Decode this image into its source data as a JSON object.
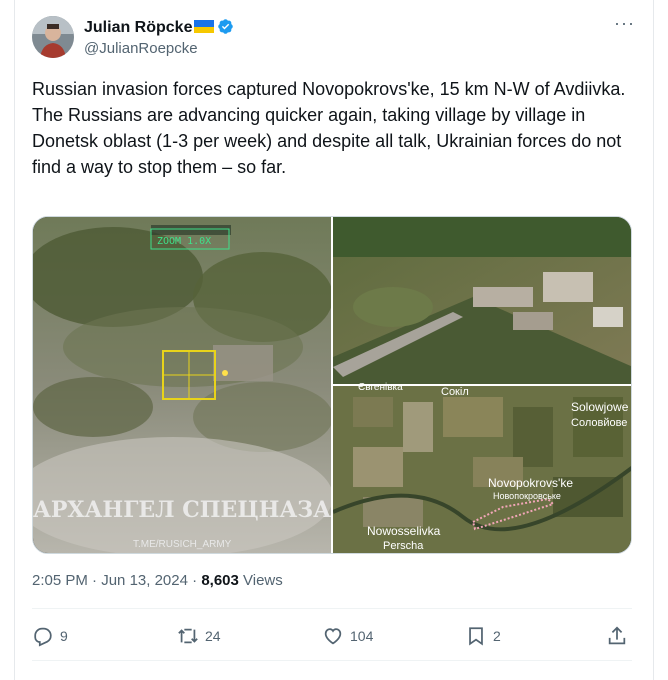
{
  "author": {
    "display_name": "Julian Röpcke",
    "handle": "@JulianRoepcke"
  },
  "tweet": {
    "line1": "Russian invasion forces captured Novopokrovs'ke, 15 km N-W of Avdiivka.",
    "line2": "The Russians are advancing quicker again, taking village by village in Donetsk oblast (1-3 per week) and despite all talk, Ukrainian forces do not find a way to stop them – so far."
  },
  "media": {
    "left": {
      "hud_zoom": "ZOOM 1.0X",
      "watermark": "АРХАНГЕЛ СПЕЦНАЗА",
      "channel": "T.ME/RUSICH_ARMY"
    },
    "map": {
      "labels": {
        "sokil": "Сокіл",
        "evgenivka": "Євгенівка",
        "solowjowe": "Solowjowe",
        "solovyove_ru": "Соловйове",
        "novopokrovske": "Novopokrovs'ke",
        "novopokrovske_ru": "Новопокровське",
        "nowosselivka": "Nowosselivka",
        "perscha": "Perscha"
      }
    }
  },
  "meta": {
    "time": "2:05 PM",
    "sep1": " · ",
    "date": "Jun 13, 2024",
    "sep2": " · ",
    "views_count": "8,603",
    "views_label": " Views"
  },
  "actions": {
    "replies": "9",
    "reposts": "24",
    "likes": "104",
    "bookmarks": "2"
  },
  "colors": {
    "brand_blue": "#1d9bf0",
    "text_secondary": "#536471",
    "route_pink": "#f2a6b8"
  }
}
